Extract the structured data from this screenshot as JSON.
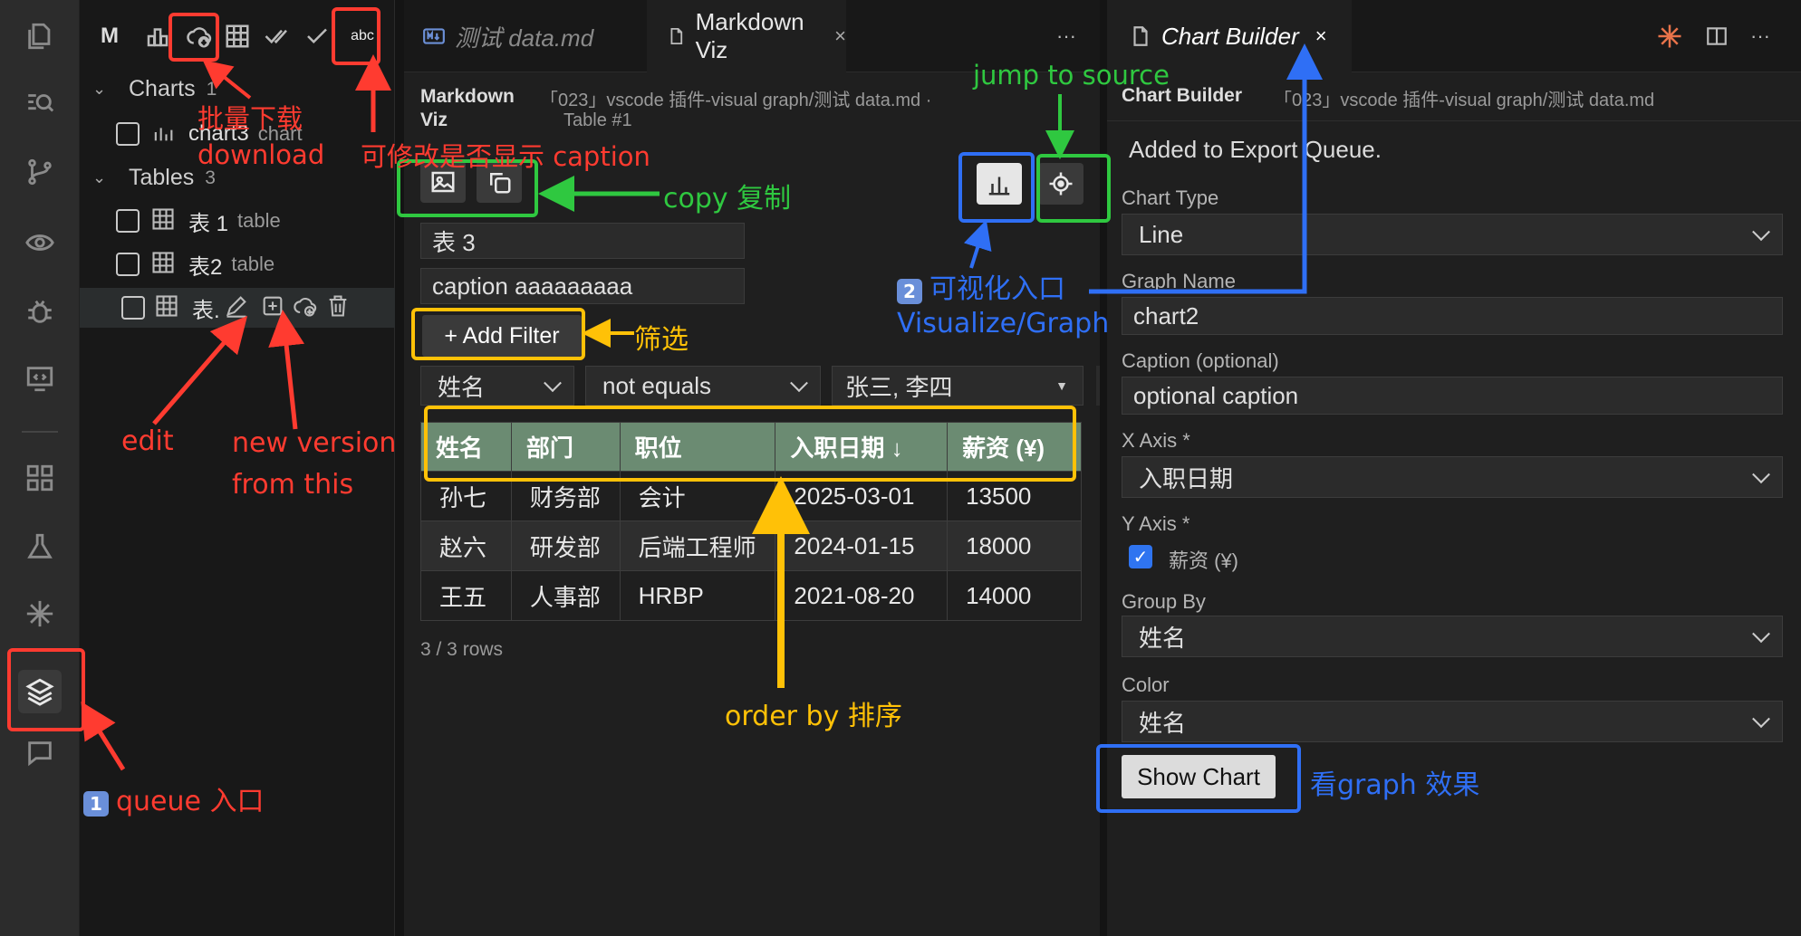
{
  "sidebar": {
    "toolbar_m": "M",
    "charts_section": "Charts",
    "charts_count": "1",
    "tables_section": "Tables",
    "tables_count": "3",
    "charts": [
      {
        "name": "chart3",
        "kind": "chart"
      }
    ],
    "tables": [
      {
        "name": "表 1",
        "kind": "table"
      },
      {
        "name": "表2",
        "kind": "table"
      },
      {
        "name": "表.",
        "kind": ""
      }
    ],
    "abc_icon": "abc"
  },
  "editor": {
    "tabs": [
      {
        "label": "测试 data.md"
      },
      {
        "label": "Markdown Viz",
        "close": "×"
      }
    ],
    "more": "···",
    "panel_title": "Markdown\nViz",
    "breadcrumb_line1": "「023」vscode 插件-visual graph/测试 data.md ·",
    "breadcrumb_line2": "Table #1",
    "table_name": "表 3",
    "caption": "caption aaaaaaaaa",
    "add_filter": "+ Add Filter",
    "filter": {
      "column": "姓名",
      "operator": "not equals",
      "value": "张三, 李四"
    },
    "columns": [
      "姓名",
      "部门",
      "职位",
      "入职日期 ↓",
      "薪资 (¥)"
    ],
    "rows": [
      [
        "孙七",
        "财务部",
        "会计",
        "2025-03-01",
        "13500"
      ],
      [
        "赵六",
        "研发部",
        "后端工程师",
        "2024-01-15",
        "18000"
      ],
      [
        "王五",
        "人事部",
        "HRBP",
        "2021-08-20",
        "14000"
      ]
    ],
    "row_count": "3 / 3 rows"
  },
  "builder": {
    "tab_label": "Chart Builder",
    "tab_close": "×",
    "more": "···",
    "title": "Chart Builder",
    "breadcrumb": "「023」vscode 插件-visual graph/测试 data.md",
    "status": "Added to Export Queue.",
    "chart_type_label": "Chart Type",
    "chart_type": "Line",
    "graph_name_label": "Graph Name",
    "graph_name": "chart2",
    "caption_label": "Caption (optional)",
    "caption_placeholder": "optional caption",
    "x_axis_label": "X Axis *",
    "x_axis": "入职日期",
    "y_axis_label": "Y Axis *",
    "y_axis_option": "薪资 (¥)",
    "group_by_label": "Group By",
    "group_by": "姓名",
    "color_label": "Color",
    "color": "姓名",
    "show_chart": "Show Chart"
  },
  "annotations": {
    "batch_download_zh": "批量下载",
    "batch_download_en": "download",
    "caption_toggle": "可修改是否显示 caption",
    "copy": "copy 复制",
    "jump_to_source": "jump to source",
    "visualize_zh": "可视化入口",
    "visualize_en": "Visualize/Graph",
    "filter": "筛选",
    "edit": "edit",
    "new_version_1": "new version",
    "new_version_2": "from this",
    "order_by": "order by 排序",
    "queue": "queue 入口",
    "queue_num": "1",
    "visualize_num": "2",
    "see_graph": "看graph 效果"
  },
  "colors": {
    "red": "#ff3b30",
    "green": "#2fc840",
    "blue": "#2f6ff5",
    "yellow": "#ffc107",
    "header_green": "#6b8b72"
  }
}
